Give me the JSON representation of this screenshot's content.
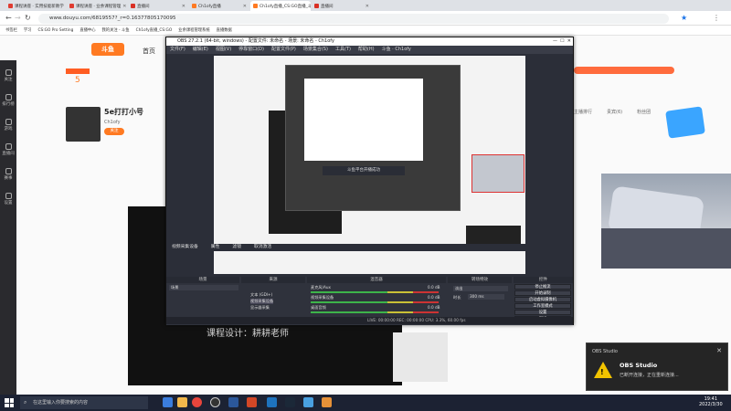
{
  "browser": {
    "tabs": [
      {
        "label": "课程讲座 · 实用技能新教学",
        "active": false
      },
      {
        "label": "课程讲座 · 业余课程管理",
        "active": false
      },
      {
        "label": "直播间",
        "active": false
      },
      {
        "label": "Ch1ofy直播",
        "active": false
      },
      {
        "label": "Ch1ofy直播_CS:GO直播_斗鱼直播",
        "active": true
      },
      {
        "label": "直播间",
        "active": false
      }
    ],
    "url": "www.douyu.com/6819557?_r=0.16377805170095",
    "bookmarks": [
      "书签栏",
      "学习",
      "CS:GO Pro Setting",
      "直播中心",
      "我的关注 - 斗鱼",
      "Ch1ofy直播_CS:GO",
      "业余课程管理系统",
      "直播数据"
    ]
  },
  "douyu": {
    "logo": "斗鱼",
    "nav_home": "首页",
    "streamer_name": "5e打打小号",
    "streamer_id": "Ch1ofy",
    "level_badge": "5",
    "follow_button": "关注",
    "room_tabs": [
      "主播排行",
      "贵宾(6)",
      "粉丝团"
    ],
    "lecture_text": "课程设计：耕耕老师",
    "side_nav": [
      "关注",
      "排行榜",
      "游戏",
      "直播间",
      "赛事",
      "设置"
    ]
  },
  "obs": {
    "title": "OBS 27.2.1 (64-bit, windows) - 配置文件: 未命名 - 场景: 未命名 - Ch1ofy",
    "menu": [
      "文件(F)",
      "编辑(E)",
      "视图(V)",
      "停靠窗口(D)",
      "配置文件(P)",
      "场景集合(S)",
      "工具(T)",
      "帮助(H)",
      "斗鱼 · Ch1ofy"
    ],
    "source_toolbar": [
      "视频采集设备",
      "属性",
      "滤镜",
      "取消激活"
    ],
    "panels": [
      "场景",
      "来源",
      "混音器",
      "转场特效",
      "控件"
    ],
    "scene_items": [
      "场景"
    ],
    "sources": [
      "文本 (GDI+)",
      "视频采集设备",
      "显示器采集"
    ],
    "mixer": [
      {
        "name": "麦克风/Aux",
        "level": "0.0 dB"
      },
      {
        "name": "视频采集设备",
        "level": "0.0 dB"
      },
      {
        "name": "桌面音频",
        "level": "0.0 dB"
      }
    ],
    "transition": "淡出",
    "duration_label": "时长",
    "duration_value": "300 ms",
    "controls": [
      "停止推流",
      "开始录制",
      "启动虚拟摄像机",
      "工作室模式",
      "设置",
      "退出"
    ],
    "status": "LIVE: 00:00:00   REC: 00:00:00   CPU: 3.3%, 60.00 fps",
    "popup_text": "斗鱼平台开播成功"
  },
  "notification": {
    "app": "OBS Studio",
    "title": "OBS Studio",
    "message": "已断开连接，正在重新连接..."
  },
  "taskbar": {
    "search_placeholder": "在这里输入你要搜索的内容",
    "time": "19:41",
    "date": "2022/3/30"
  }
}
